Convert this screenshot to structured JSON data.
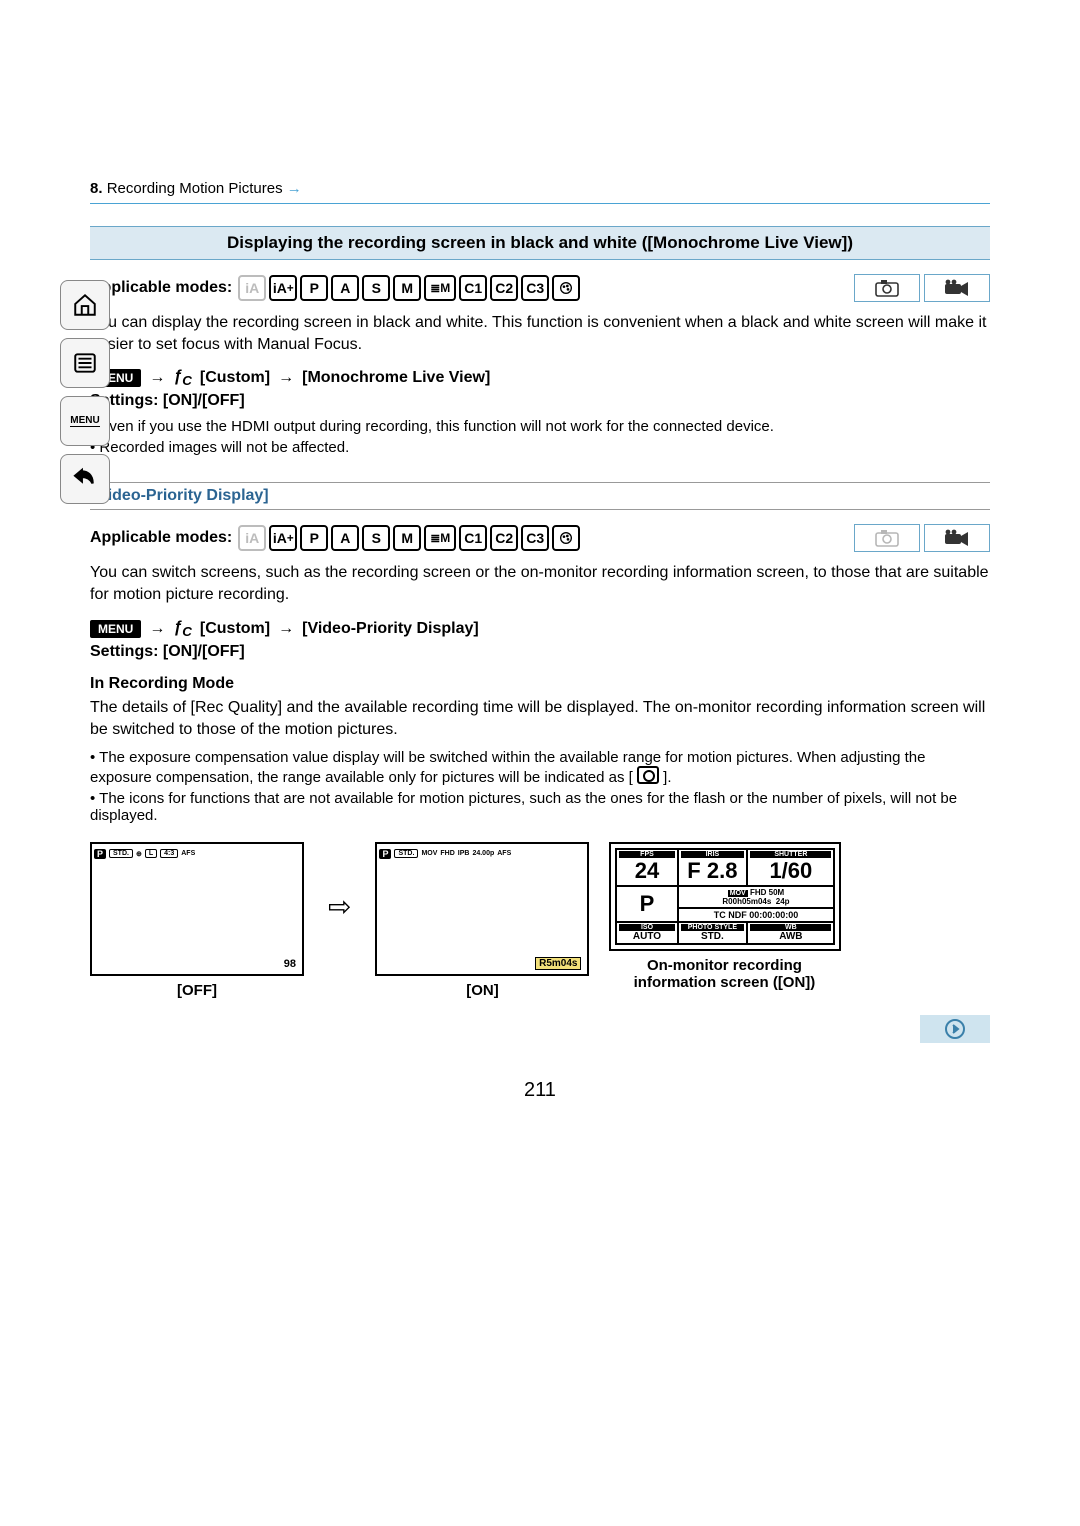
{
  "chapter": {
    "number": "8.",
    "title": "Recording Motion Pictures"
  },
  "section1": {
    "title": "Displaying the recording screen in black and white ([Monochrome Live View])",
    "modes_label": "Applicable modes:",
    "modes": [
      "iA",
      "iA+",
      "P",
      "A",
      "S",
      "M",
      "#M",
      "C1",
      "C2",
      "C3",
      "☆"
    ],
    "intro": "You can display the recording screen in black and white. This function is convenient when a black and white screen will make it easier to set focus with Manual Focus.",
    "path_custom": "[Custom]",
    "path_item": "[Monochrome Live View]",
    "settings": "Settings: [ON]/[OFF]",
    "bullets": [
      "Even if you use the HDMI output during recording, this function will not work for the connected device.",
      "Recorded images will not be affected."
    ]
  },
  "section2": {
    "title": "[Video-Priority Display]",
    "modes_label": "Applicable modes:",
    "intro": "You can switch screens, such as the recording screen or the on-monitor recording information screen, to those that are suitable for motion picture recording.",
    "path_custom": "[Custom]",
    "path_item": "[Video-Priority Display]",
    "settings": "Settings: [ON]/[OFF]",
    "sub_heading": "In Recording Mode",
    "sub_text": "The details of [Rec Quality] and the available recording time will be displayed. The on-monitor recording information screen will be switched to those of the motion pictures.",
    "bullets": [
      "The exposure compensation value display will be switched within the available range for motion pictures. When adjusting the exposure compensation, the range available only for pictures will be indicated as [",
      "The icons for functions that are not available for motion pictures, such as the ones for the flash or the number of pixels, will not be displayed."
    ],
    "bullet1_tail": "]."
  },
  "sidebar": {
    "home": "home-icon",
    "toc": "list-icon",
    "menu_label": "MENU",
    "back": "back-icon"
  },
  "menu_badge": "MENU",
  "arrow": "→",
  "shots": {
    "off_label": "[OFF]",
    "on_label": "[ON]",
    "mon_label1": "On-monitor recording",
    "mon_label2": "information screen ([ON])",
    "off_badges": [
      "P",
      "STD."
    ],
    "off_count": "98",
    "on_badges": [
      "P",
      "STD.",
      "MOV",
      "FHD",
      "IPB",
      "24.00p",
      "AFS"
    ],
    "on_time": "R5m04s",
    "mon": {
      "fps_lab": "FPS",
      "fps": "24",
      "iris_lab": "IRIS",
      "iris": "F 2.8",
      "shutter_lab": "SHUTTER",
      "shutter": "1/60",
      "mode": "P",
      "mov": "MOV",
      "fhd": "FHD",
      "bit": "50M",
      "rate": "24p",
      "remain": "R00h05m04s",
      "tc_lab": "TC NDF",
      "tc": "00:00:00:00",
      "iso_lab": "ISO",
      "iso": "AUTO",
      "ps_lab": "PHOTO STYLE",
      "ps": "STD.",
      "wb_lab": "WB",
      "wb": "AWB"
    }
  },
  "page_number": "211"
}
